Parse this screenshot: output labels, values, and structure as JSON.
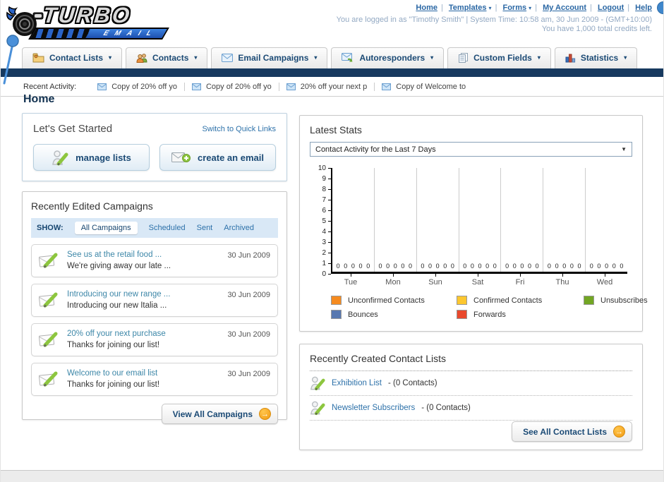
{
  "header": {
    "logo_title": "TURBO",
    "logo_subtitle": "EMAIL",
    "nav": {
      "home": "Home",
      "templates": "Templates",
      "forms": "Forms",
      "my_account": "My Account",
      "logout": "Logout",
      "help": "Help"
    },
    "login_line": "You are logged in as \"Timothy Smith\" | System Time: 10:58 am, 30 Jun 2009 - (GMT+10:00)",
    "credits_line": "You have 1,000 total credits left."
  },
  "tabs": [
    {
      "label": "Contact Lists",
      "icon": "folder-user-icon"
    },
    {
      "label": "Contacts",
      "icon": "users-icon"
    },
    {
      "label": "Email Campaigns",
      "icon": "envelope-icon"
    },
    {
      "label": "Autoresponders",
      "icon": "envelope-reply-icon"
    },
    {
      "label": "Custom Fields",
      "icon": "pages-icon"
    },
    {
      "label": "Statistics",
      "icon": "bar-chart-icon"
    }
  ],
  "recent_activity": {
    "label": "Recent Activity:",
    "items": [
      "Copy of 20% off yo",
      "Copy of 20% off yo",
      "20% off your next p",
      "Copy of Welcome to"
    ]
  },
  "page_title": "Home",
  "get_started": {
    "title": "Let's Get Started",
    "switch_link": "Switch to Quick Links",
    "manage_lists_button": "manage lists",
    "create_email_button": "create an email"
  },
  "campaigns": {
    "title": "Recently Edited Campaigns",
    "show_label": "SHOW:",
    "filters": [
      "All Campaigns",
      "Scheduled",
      "Sent",
      "Archived"
    ],
    "active_filter": "All Campaigns",
    "items": [
      {
        "title": "See us at the retail food ...",
        "subtitle": "We're giving away our late ...",
        "date": "30 Jun 2009"
      },
      {
        "title": "Introducing our new range ...",
        "subtitle": "Introducing our new Italia ...",
        "date": "30 Jun 2009"
      },
      {
        "title": "20% off your next purchase",
        "subtitle": "Thanks for joining our list!",
        "date": "30 Jun 2009"
      },
      {
        "title": "Welcome to our email list",
        "subtitle": "Thanks for joining our list!",
        "date": "30 Jun 2009"
      }
    ],
    "view_all_button": "View All Campaigns"
  },
  "stats": {
    "title": "Latest Stats",
    "selected_option": "Contact Activity for the Last 7 Days"
  },
  "chart_data": {
    "type": "bar",
    "title": "Contact Activity for the Last 7 Days",
    "categories": [
      "Tue",
      "Mon",
      "Sun",
      "Sat",
      "Fri",
      "Thu",
      "Wed"
    ],
    "series": [
      {
        "name": "Unconfirmed Contacts",
        "color": "#f68b1f",
        "values": [
          0,
          0,
          0,
          0,
          0,
          0,
          0
        ]
      },
      {
        "name": "Confirmed Contacts",
        "color": "#fdc72f",
        "values": [
          0,
          0,
          0,
          0,
          0,
          0,
          0
        ]
      },
      {
        "name": "Unsubscribes",
        "color": "#72a623",
        "values": [
          0,
          0,
          0,
          0,
          0,
          0,
          0
        ]
      },
      {
        "name": "Bounces",
        "color": "#5878b0",
        "values": [
          0,
          0,
          0,
          0,
          0,
          0,
          0
        ]
      },
      {
        "name": "Forwards",
        "color": "#e9492d",
        "values": [
          0,
          0,
          0,
          0,
          0,
          0,
          0
        ]
      }
    ],
    "ylim": [
      0,
      10
    ],
    "y_ticks": [
      10,
      9,
      8,
      7,
      6,
      5,
      4,
      3,
      2,
      1,
      0
    ],
    "grid": "vertical",
    "legend_position": "bottom"
  },
  "contact_lists": {
    "title": "Recently Created Contact Lists",
    "items": [
      {
        "name": "Exhibition List",
        "detail": "- (0 Contacts)"
      },
      {
        "name": "Newsletter Subscribers",
        "detail": "- (0 Contacts)"
      }
    ],
    "see_all_button": "See All Contact Lists"
  }
}
